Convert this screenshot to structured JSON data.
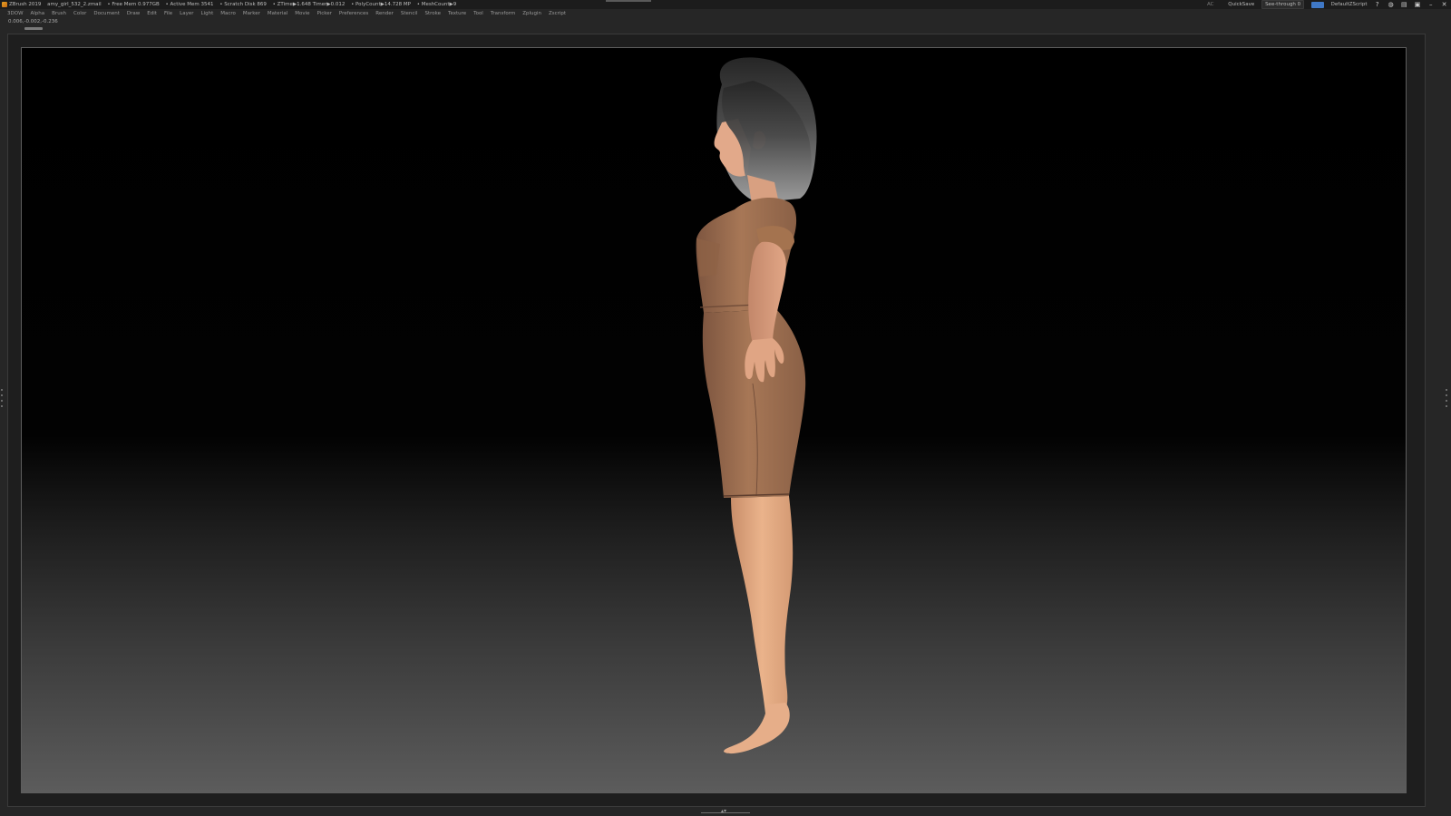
{
  "titlebar": {
    "app_name": "ZBrush 2019",
    "file_name": "amy_girl_532_2.zmail",
    "free_mem": "• Free Mem 0.977GB",
    "active_mem": "• Active Mem 3541",
    "scratch_disk": "• Scratch Disk 869",
    "ztime": "• ZTime▶1.648 Timer▶0.012",
    "polycount": "• PolyCount▶14.728 MP",
    "meshcount": "• MeshCount▶9",
    "ac_label": "AC",
    "quicksave_label": "QuickSave",
    "seethrough_label": "See-through  0",
    "seethrough_value": 0,
    "script_label": "DefaultZScript"
  },
  "menubar": {
    "items": [
      "3DOW",
      "Alpha",
      "Brush",
      "Color",
      "Document",
      "Draw",
      "Edit",
      "File",
      "Layer",
      "Light",
      "Macro",
      "Marker",
      "Material",
      "Movie",
      "Picker",
      "Preferences",
      "Render",
      "Stencil",
      "Stroke",
      "Texture",
      "Tool",
      "Transform",
      "Zplugin",
      "Zscript"
    ]
  },
  "canvas": {
    "coordinates": "0.006,-0.002,-0.236"
  },
  "colors": {
    "accent_blue": "#3f78c6",
    "seethrough_green": "#6ecb3a",
    "dress": "#a47354",
    "skin": "#e7ad83",
    "hair_top": "#2b2b2b",
    "hair_bottom": "#9a9a9a"
  },
  "icons": [
    "zbrush-logo-icon",
    "help-icon",
    "palette-icon",
    "layout-icon",
    "lock-icon",
    "minimize-icon",
    "close-icon"
  ]
}
